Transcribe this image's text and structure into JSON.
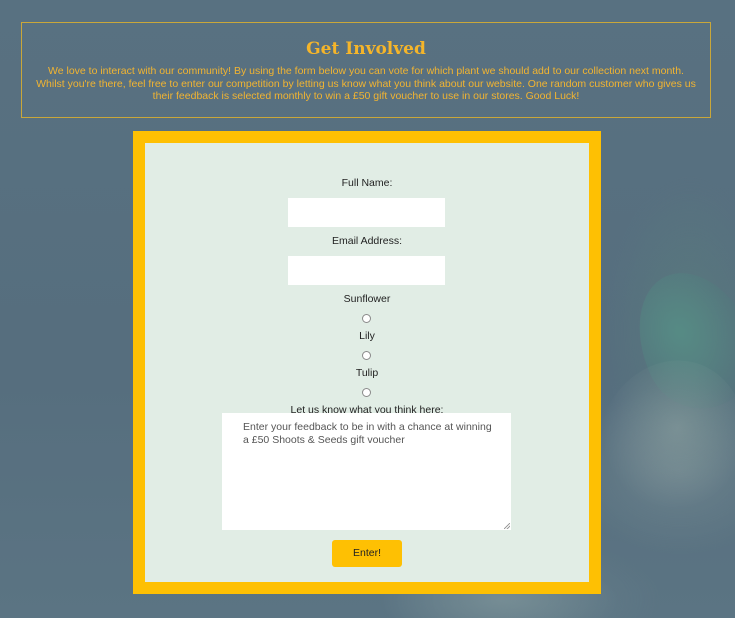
{
  "header": {
    "title": "Get Involved",
    "text": "We love to interact with our community! By using the form below you can vote for which plant we should add to our collection next month. Whilst you're there, feel free to enter our competition by letting us know what you think about our website. One random customer who gives us their feedback is selected monthly to win a £50 gift voucher to use in our stores. Good Luck!"
  },
  "form": {
    "full_name_label": "Full Name:",
    "full_name_value": "",
    "email_label": "Email Address:",
    "email_value": "",
    "plant_options": [
      "Sunflower",
      "Lily",
      "Tulip"
    ],
    "feedback_label": "Let us know what you think here:",
    "feedback_placeholder": "Enter your feedback to be in with a chance at winning a £50 Shoots & Seeds gift voucher",
    "submit_label": "Enter!"
  },
  "colors": {
    "accent": "#fec003",
    "heading": "#f5b52a",
    "panel": "#e1ede5",
    "background": "#566f80"
  }
}
